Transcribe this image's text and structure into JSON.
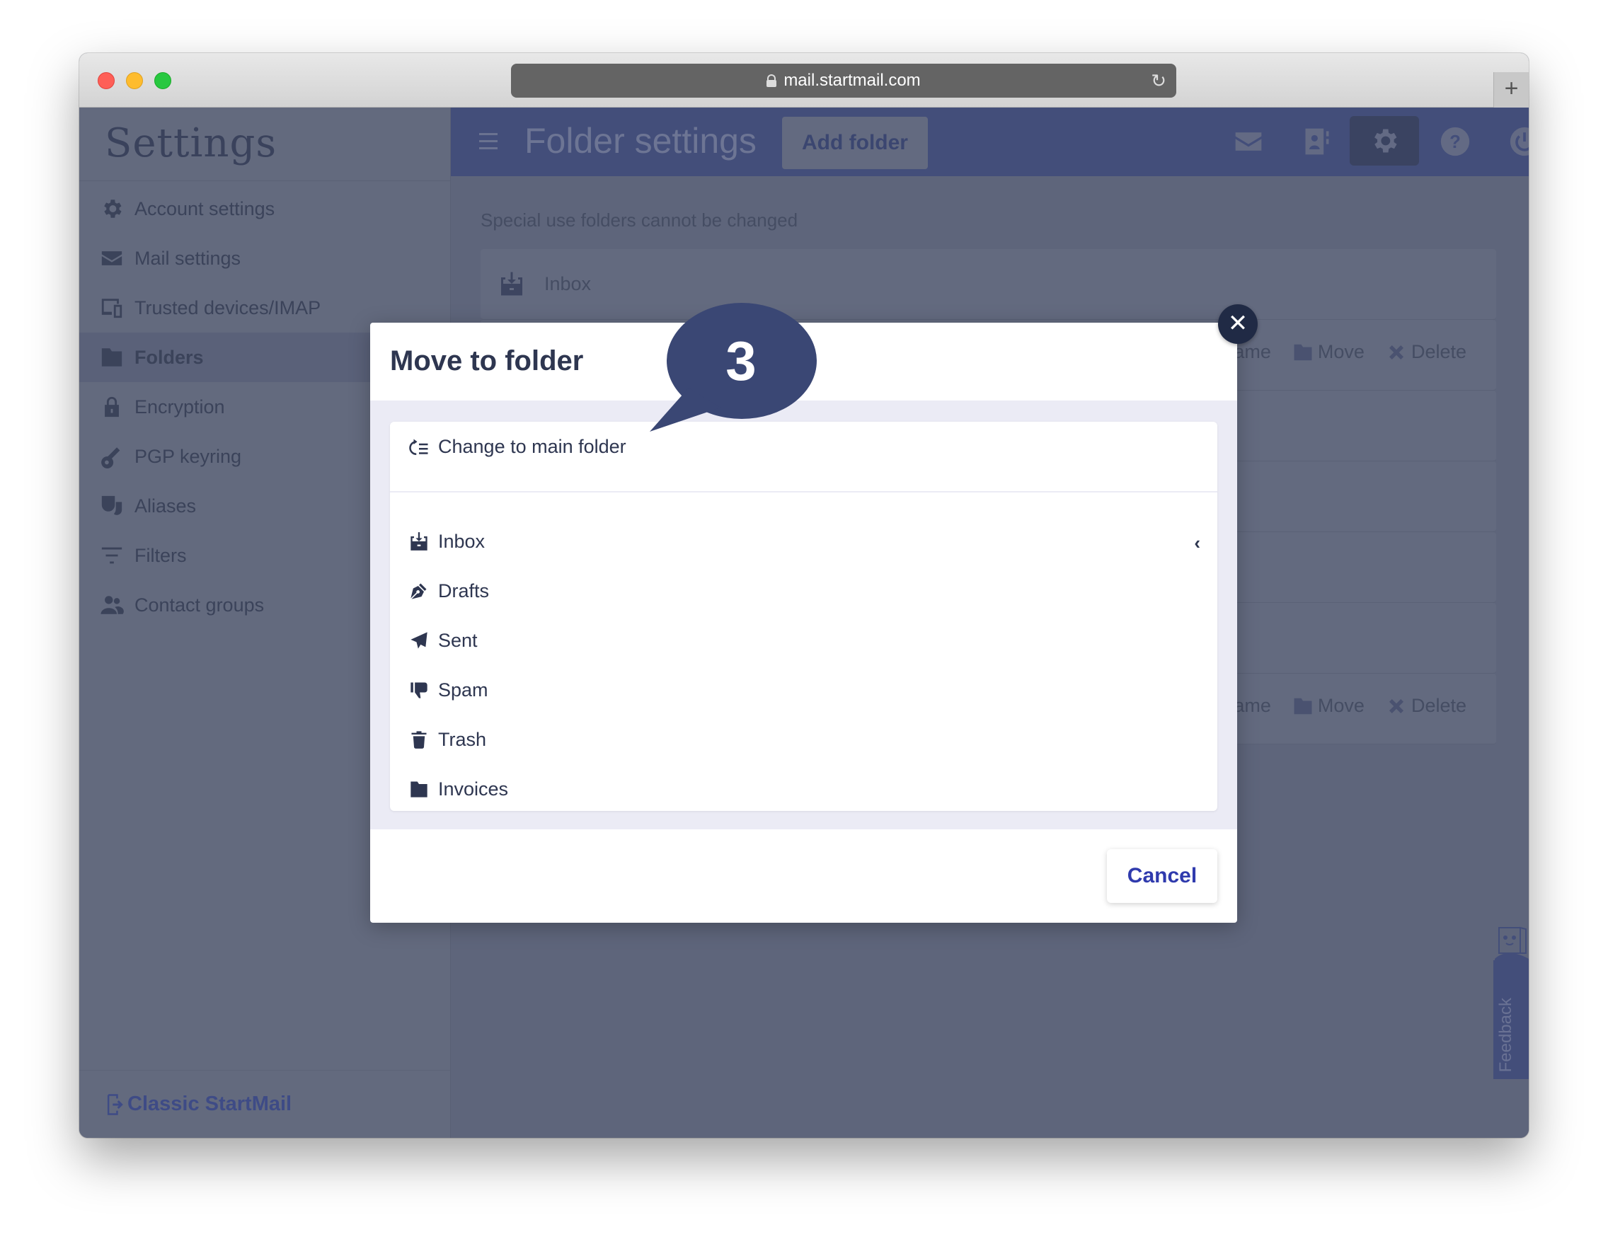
{
  "browser": {
    "url": "mail.startmail.com",
    "reload_icon": "reload-icon",
    "new_tab_label": "+"
  },
  "sidebar": {
    "title": "Settings",
    "items": [
      {
        "label": "Account settings",
        "icon": "gear-icon",
        "active": false
      },
      {
        "label": "Mail settings",
        "icon": "envelope-icon",
        "active": false
      },
      {
        "label": "Trusted devices/IMAP",
        "icon": "devices-icon",
        "active": false
      },
      {
        "label": "Folders",
        "icon": "folder-icon",
        "active": true
      },
      {
        "label": "Encryption",
        "icon": "lock-icon",
        "active": false
      },
      {
        "label": "PGP keyring",
        "icon": "key-icon",
        "active": false
      },
      {
        "label": "Aliases",
        "icon": "masks-icon",
        "active": false
      },
      {
        "label": "Filters",
        "icon": "filter-icon",
        "active": false
      },
      {
        "label": "Contact groups",
        "icon": "users-icon",
        "active": false
      }
    ],
    "footer_link": "Classic StartMail"
  },
  "header": {
    "title": "Folder settings",
    "add_folder_label": "Add folder",
    "icons": [
      "mail-icon",
      "contacts-icon",
      "settings-icon",
      "help-icon",
      "power-icon"
    ],
    "active_icon": "settings-icon"
  },
  "main": {
    "notice": "Special use folders cannot be changed",
    "rows": [
      {
        "label": "Inbox"
      }
    ],
    "row_actions": {
      "rename_partial": "ame",
      "move": "Move",
      "delete": "Delete"
    },
    "feedback_label": "Feedback"
  },
  "modal": {
    "title": "Move to folder",
    "change_main_label": "Change to main folder",
    "folders": [
      {
        "label": "Inbox",
        "icon": "inbox-icon",
        "expandable": true
      },
      {
        "label": "Drafts",
        "icon": "pen-icon",
        "expandable": false
      },
      {
        "label": "Sent",
        "icon": "paper-plane-icon",
        "expandable": false
      },
      {
        "label": "Spam",
        "icon": "thumbs-down-icon",
        "expandable": false
      },
      {
        "label": "Trash",
        "icon": "trash-icon",
        "expandable": false
      },
      {
        "label": "Invoices",
        "icon": "folder-icon",
        "expandable": false
      }
    ],
    "expand_glyph": "‹",
    "cancel_label": "Cancel",
    "close_glyph": "✕"
  },
  "annotation": {
    "step_number": "3"
  },
  "colors": {
    "brand_header": "#434e7a",
    "modal_text": "#2e3650",
    "cancel_text": "#2f3aad",
    "callout": "#3a4774",
    "close_button": "#202a45"
  }
}
